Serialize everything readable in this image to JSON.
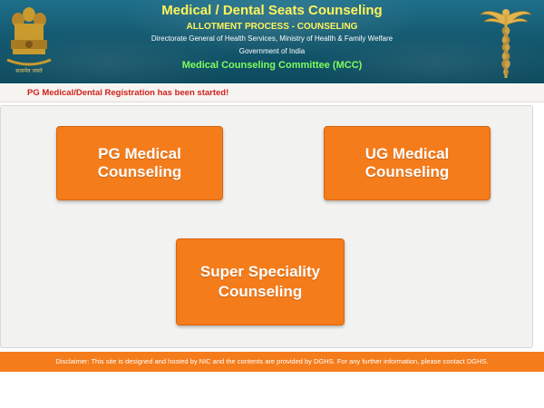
{
  "header": {
    "title": "Medical / Dental Seats Counseling",
    "subtitle": "ALLOTMENT PROCESS - COUNSELING",
    "directorate": "Directorate General of Health Services, Ministry of Health & Family Welfare",
    "government": "Government of India",
    "committee": "Medical Counseling Committee (MCC)",
    "left_logo": "national-emblem",
    "right_logo": "caduceus"
  },
  "notice": {
    "text": "PG Medical/Dental Registration has been started!"
  },
  "buttons": {
    "pg": "PG Medical Counseling",
    "ug": "UG Medical Counseling",
    "ss_line1": "Super Speciality",
    "ss_line2": "Counseling"
  },
  "footer": {
    "disclaimer": "Disclaimer: This site is designed and hosted by NIC and the contents are provided by DGHS. For any further information, please contact DGHS."
  },
  "colors": {
    "header_bg": "#13596f",
    "title": "#fff35a",
    "committee": "#7dff5c",
    "notice_text": "#d0201c",
    "button": "#f57c1b",
    "footer": "#f57c1b"
  }
}
